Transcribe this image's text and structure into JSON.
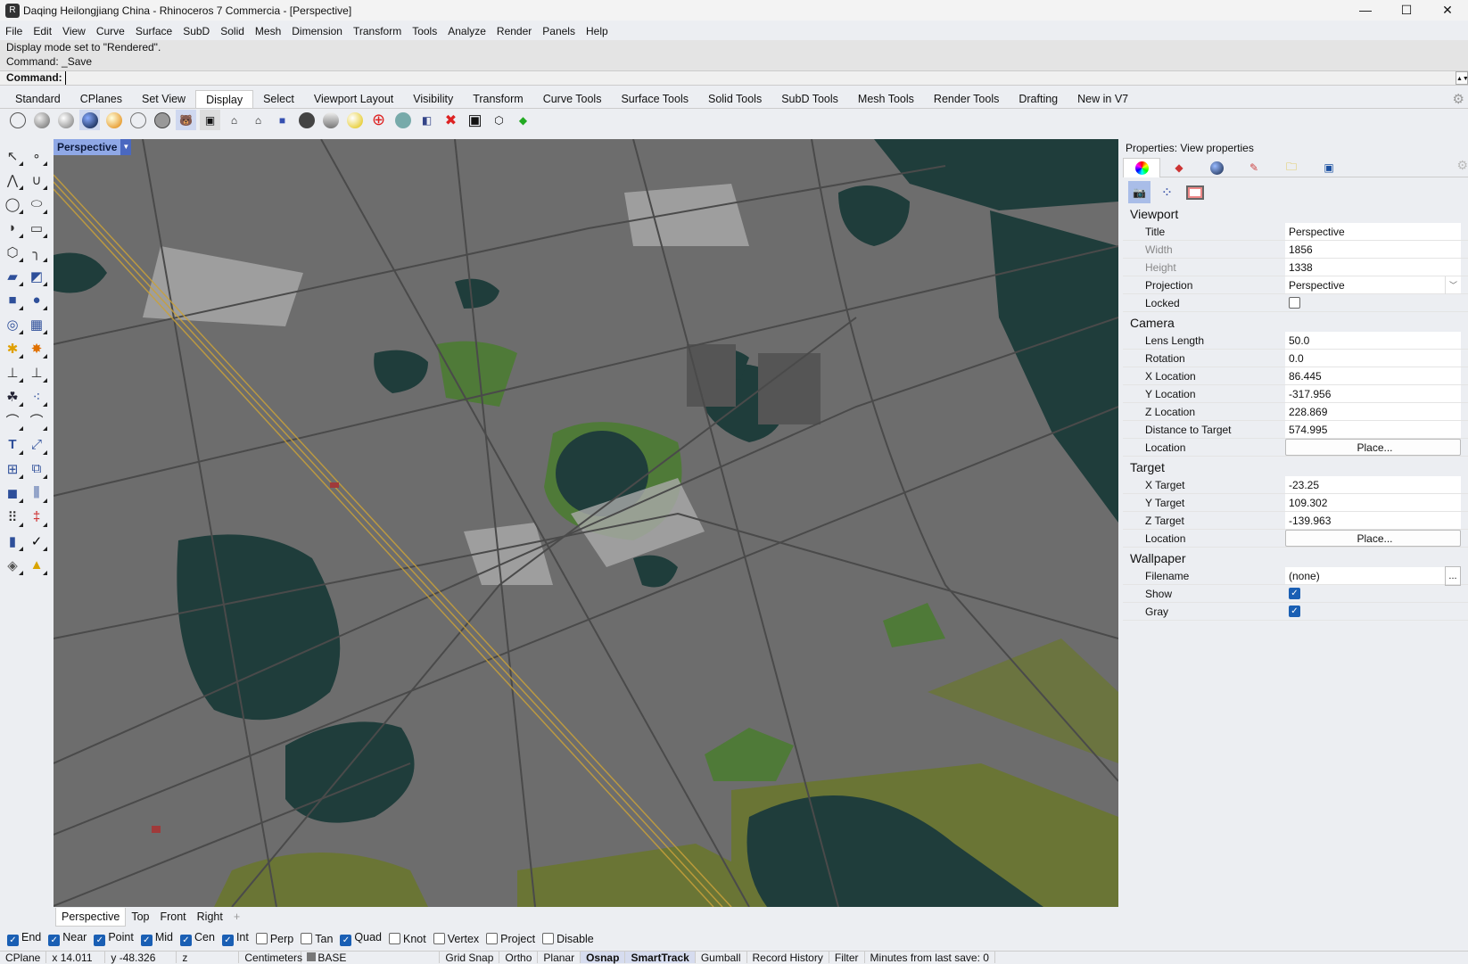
{
  "window": {
    "title": "Daqing Heilongjiang China - Rhinoceros 7 Commercia - [Perspective]",
    "minimize": "—",
    "maximize": "☐",
    "close": "✕"
  },
  "menu": [
    "File",
    "Edit",
    "View",
    "Curve",
    "Surface",
    "SubD",
    "Solid",
    "Mesh",
    "Dimension",
    "Transform",
    "Tools",
    "Analyze",
    "Render",
    "Panels",
    "Help"
  ],
  "command": {
    "history": [
      "Display mode set to \"Rendered\".",
      "Command: _Save"
    ],
    "prompt": "Command:"
  },
  "toolbar_tabs": [
    "Standard",
    "CPlanes",
    "Set View",
    "Display",
    "Select",
    "Viewport Layout",
    "Visibility",
    "Transform",
    "Curve Tools",
    "Surface Tools",
    "Solid Tools",
    "SubD Tools",
    "Mesh Tools",
    "Render Tools",
    "Drafting",
    "New in V7"
  ],
  "active_toolbar_tab": "Display",
  "viewport": {
    "label": "Perspective"
  },
  "viewport_tabs": [
    "Perspective",
    "Top",
    "Front",
    "Right"
  ],
  "viewport_add": "+",
  "osnaps": [
    {
      "label": "End",
      "on": true
    },
    {
      "label": "Near",
      "on": true
    },
    {
      "label": "Point",
      "on": true
    },
    {
      "label": "Mid",
      "on": true
    },
    {
      "label": "Cen",
      "on": true
    },
    {
      "label": "Int",
      "on": true
    },
    {
      "label": "Perp",
      "on": false
    },
    {
      "label": "Tan",
      "on": false
    },
    {
      "label": "Quad",
      "on": true
    },
    {
      "label": "Knot",
      "on": false
    },
    {
      "label": "Vertex",
      "on": false
    },
    {
      "label": "Project",
      "on": false
    },
    {
      "label": "Disable",
      "on": false
    }
  ],
  "status": {
    "cplane": "CPlane",
    "x": "x 14.011",
    "y": "y -48.326",
    "z": "z",
    "units": "Centimeters",
    "layer": "BASE",
    "grid_snap": "Grid Snap",
    "ortho": "Ortho",
    "planar": "Planar",
    "osnap": "Osnap",
    "smarttrack": "SmartTrack",
    "gumball": "Gumball",
    "record_history": "Record History",
    "filter": "Filter",
    "minutes": "Minutes from last save: 0"
  },
  "properties": {
    "title": "Properties: View properties",
    "viewport": {
      "heading": "Viewport",
      "title_label": "Title",
      "title": "Perspective",
      "width_label": "Width",
      "width": "1856",
      "height_label": "Height",
      "height": "1338",
      "projection_label": "Projection",
      "projection": "Perspective",
      "locked_label": "Locked"
    },
    "camera": {
      "heading": "Camera",
      "lens_label": "Lens Length",
      "lens": "50.0",
      "rotation_label": "Rotation",
      "rotation": "0.0",
      "x_label": "X Location",
      "x": "86.445",
      "y_label": "Y Location",
      "y": "-317.956",
      "z_label": "Z Location",
      "z": "228.869",
      "dist_label": "Distance to Target",
      "dist": "574.995",
      "loc_label": "Location",
      "place": "Place..."
    },
    "target": {
      "heading": "Target",
      "x_label": "X Target",
      "x": "-23.25",
      "y_label": "Y Target",
      "y": "109.302",
      "z_label": "Z Target",
      "z": "-139.963",
      "loc_label": "Location",
      "place": "Place..."
    },
    "wallpaper": {
      "heading": "Wallpaper",
      "filename_label": "Filename",
      "filename": "(none)",
      "browse": "...",
      "show_label": "Show",
      "gray_label": "Gray"
    }
  },
  "colors": {
    "lake": "#1f3d3b",
    "olive": "#6a7535",
    "park": "#4f7a38",
    "ground": "#6d6d6d",
    "road": "#4a4a4a",
    "rail": "#c9a13a"
  }
}
